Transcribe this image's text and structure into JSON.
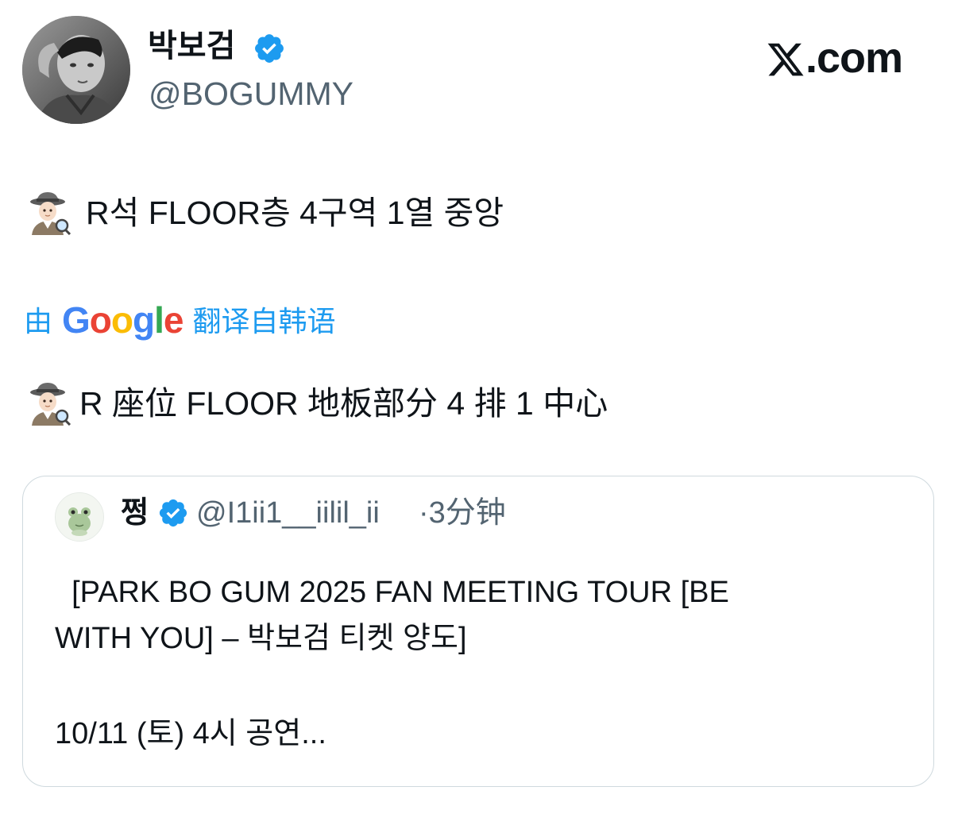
{
  "author": {
    "display_name": "박보검",
    "handle": "@BOGUMMY",
    "verified": true,
    "avatar": "profile-photo"
  },
  "site_logo": {
    "icon": "x-logo-icon",
    "text": ".com"
  },
  "tweet": {
    "emoji": "detective-emoji",
    "text": "R석 FLOOR층 4구역 1열 중앙"
  },
  "translation": {
    "prefix": "由",
    "logo_text": [
      "G",
      "o",
      "o",
      "g",
      "l",
      "e"
    ],
    "suffix": "翻译自韩语",
    "emoji": "detective-emoji",
    "text": "R 座位 FLOOR 地板部分 4 排 1 中心"
  },
  "quoted_tweet": {
    "display_name": "쩡",
    "verified": true,
    "handle": "@I1ii1__iilil_ii",
    "separator": "·",
    "time": "3分钟",
    "avatar": "frog-avatar-icon",
    "body_lines": [
      "  [PARK BO GUM 2025 FAN MEETING TOUR [BE",
      "WITH YOU] – 박보검 티켓 양도]",
      "10/11 (토) 4시 공연..."
    ]
  },
  "colors": {
    "link_blue": "#1d9bf0",
    "verified_blue": "#1d9bf0",
    "secondary_text": "#536471",
    "primary_text": "#0f1419",
    "card_border": "#cfd9de"
  }
}
